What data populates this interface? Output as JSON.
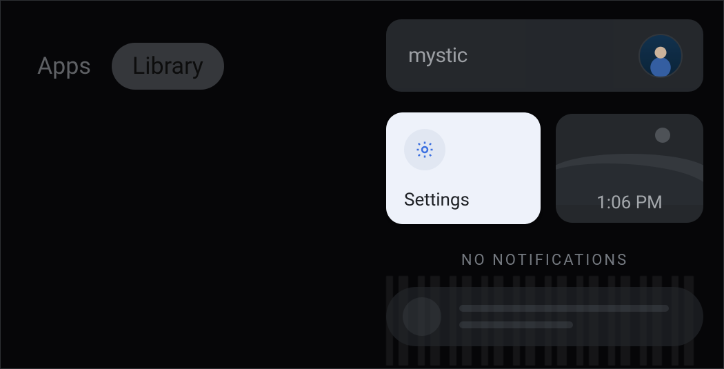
{
  "tabs": {
    "inactive_label": "Apps",
    "active_label": "Library"
  },
  "device": {
    "name": "mystic"
  },
  "settings": {
    "label": "Settings",
    "icon_name": "gear-icon"
  },
  "clock": {
    "time": "1:06 PM"
  },
  "notifications": {
    "empty_label": "NO NOTIFICATIONS"
  }
}
